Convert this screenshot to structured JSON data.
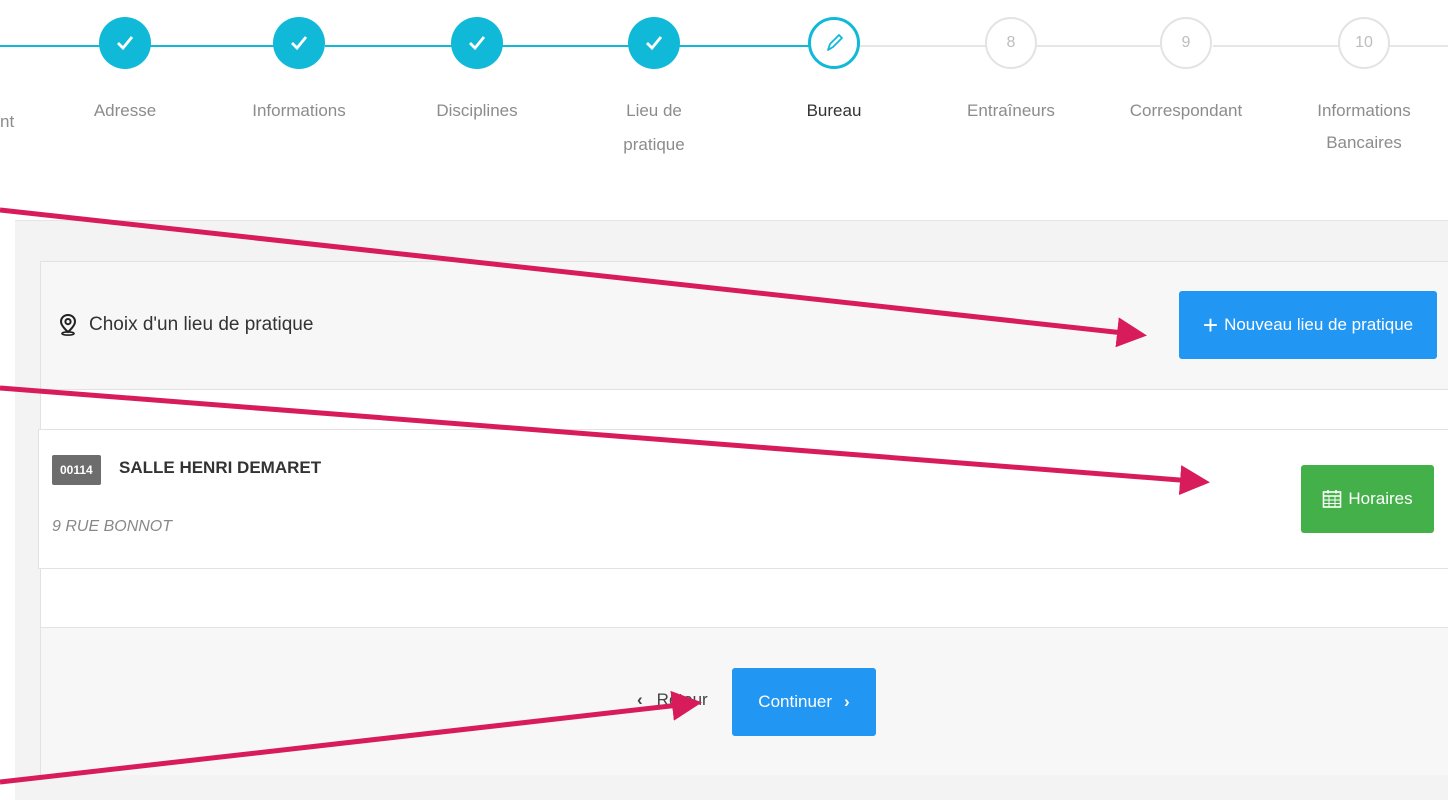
{
  "stepper": {
    "partial_label": "nt",
    "steps": [
      {
        "label": "Adresse",
        "state": "done",
        "icon": "check-icon"
      },
      {
        "label": "Informations",
        "state": "done",
        "icon": "check-icon"
      },
      {
        "label": "Disciplines",
        "state": "done",
        "icon": "check-icon"
      },
      {
        "label": "Lieu de pratique",
        "state": "done",
        "icon": "check-icon"
      },
      {
        "label": "Bureau",
        "state": "current",
        "icon": "pencil-icon"
      },
      {
        "label": "Entraîneurs",
        "state": "todo",
        "number": "8"
      },
      {
        "label": "Correspondant",
        "state": "todo",
        "number": "9"
      },
      {
        "label": "Informations",
        "label_2": "Bancaires",
        "state": "todo",
        "number": "10"
      }
    ],
    "colors": {
      "done": "#10b9d8",
      "todo": "#e6e6e6"
    }
  },
  "panel": {
    "title": "Choix d'un lieu de pratique",
    "title_icon": "map-pin-icon",
    "new_button": {
      "label": "Nouveau lieu de pratique",
      "icon": "plus-icon",
      "color": "#2196f3"
    }
  },
  "place": {
    "code": "00114",
    "name": "SALLE HENRI DEMARET",
    "address": "9 RUE BONNOT",
    "horaires_button": {
      "label": "Horaires",
      "icon": "calendar-icon",
      "color": "#43b049"
    }
  },
  "footer": {
    "back_label": "Retour",
    "continue_label": "Continuer",
    "continue_color": "#2196f3"
  },
  "annotations": {
    "arrow_color": "#d81b5a"
  }
}
